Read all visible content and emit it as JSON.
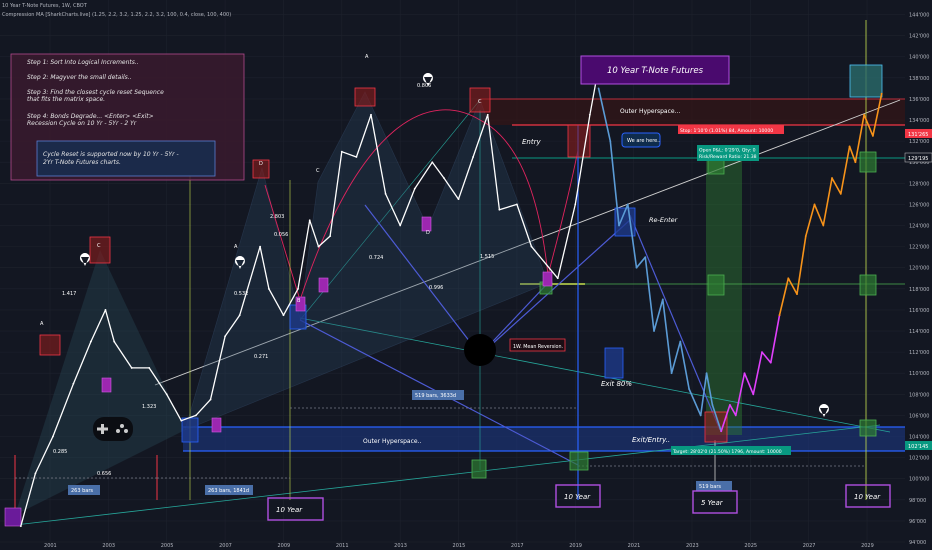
{
  "header": {
    "symbol_line": "10 Year T-Note Futures, 1W, CBOT",
    "indicator_line": "Compression MA [SharkCharts.live] (1.25, 2.2, 3.2, 1.25, 2.2, 3.2, 100, 0.4, close, 100, 400)"
  },
  "notes": {
    "steps": [
      "Step 1: Sort Into Logical Increments..",
      "Step 2: Magyver the small details..",
      "Step 3: Find the closest cycle reset Sequence",
      "that fits the matrix space.",
      "Step 4: Bonds Degrade... <Enter> <Exit>",
      "Recession Cycle on 10 Yr - 5Yr - 2 Yr"
    ],
    "cycle_box": [
      "Cycle Reset is supported now by 10 Yr - 5Yr -",
      "2Yr T-Note Futures charts."
    ]
  },
  "title_box": "10 Year T-Note Futures",
  "colors": {
    "background": "#131722",
    "price": "#ffffff",
    "projection_blue": "#5b9bd5",
    "projection_orange": "#f7931a",
    "projection_magenta": "#e040fb",
    "stop": "#f23645",
    "target": "#089981"
  },
  "labels": {
    "outer_top": "Outer Hyperspace...",
    "outer_bottom": "Outer Hyperspace..",
    "entry": "Entry",
    "we_are_here": "We are here..",
    "re_enter": "Re-Enter",
    "mean_reversion": "1W. Mean Reversion.",
    "exit80": "Exit 80%",
    "exit_entry": "Exit/Entry..",
    "ten_year": "10 Year",
    "five_year": "5 Year",
    "stop_label": "Stop: 1'10'0 (1.01%) 84, Amount: 10000",
    "pnl_1": "Open P&L: 0'29'0, Qty: 0",
    "pnl_2": "Risk/Reward Ratio: 21.38",
    "target_label": "Target: 28'02'0 (21.50%) 1796, Amount: 10000",
    "bars_519_a": "519 bars, 3633d",
    "bars_519_b": "519 bars",
    "bars_263_a": "263 bars",
    "bars_263_b": "263 bars, 1841d",
    "fibs": [
      "1.417",
      "0.285",
      "0.656",
      "1.323",
      "0.532",
      "0.271",
      "2.803",
      "0.056",
      "0.724",
      "0.996",
      "1.515",
      "0.806"
    ],
    "points": [
      "A",
      "B",
      "C",
      "D",
      "X"
    ]
  },
  "price_labels": {
    "stop": "131'265",
    "current": "129'195",
    "target": "102'145"
  },
  "chart_data": {
    "type": "line",
    "title": "10 Year T-Note Futures",
    "xlabel": "",
    "ylabel": "",
    "x_ticks": [
      "2001",
      "2003",
      "2005",
      "2007",
      "2009",
      "2011",
      "2013",
      "2015",
      "2017",
      "2019",
      "2021",
      "2023",
      "2025",
      "2027",
      "2029"
    ],
    "y_ticks": [
      "144'000",
      "142'000",
      "140'000",
      "138'000",
      "136'000",
      "134'000",
      "132'000",
      "130'000",
      "128'000",
      "126'000",
      "124'000",
      "122'000",
      "120'000",
      "118'000",
      "116'000",
      "114'000",
      "112'000",
      "110'000",
      "108'000",
      "106'000",
      "104'000",
      "102'000",
      "100'000",
      "98'000",
      "96'000",
      "94'000"
    ],
    "y_range": [
      94,
      145
    ],
    "x_range": [
      2000.3,
      2030.8
    ],
    "series": [
      {
        "x": [
          2000.5,
          2001.0,
          2001.6,
          2002.3,
          2002.9,
          2003.4,
          2003.7,
          2004.3,
          2004.9,
          2005.5,
          2006.0,
          2006.5,
          2007.0,
          2007.5,
          2008.0,
          2008.7,
          2009.0,
          2009.5,
          2010.0,
          2010.4,
          2010.7,
          2011.1,
          2011.5,
          2012.0,
          2012.5,
          2013.0,
          2013.5,
          2014.0,
          2014.6,
          2015.0,
          2015.5,
          2016.0,
          2016.5,
          2016.9,
          2017.5,
          2018.0,
          2018.9,
          2019.5,
          2020.0,
          2020.3
        ],
        "y": [
          95.5,
          100.5,
          104.0,
          109.0,
          113.0,
          116.0,
          113.0,
          110.5,
          110.5,
          108.0,
          105.5,
          106.0,
          107.5,
          113.5,
          115.5,
          122.0,
          118.0,
          115.5,
          118.0,
          124.5,
          122.0,
          123.0,
          131.0,
          130.5,
          134.5,
          127.0,
          124.0,
          127.5,
          130.0,
          128.5,
          126.5,
          130.5,
          134.5,
          125.5,
          126.0,
          122.0,
          119.0,
          126.0,
          134.5,
          139.0
        ]
      },
      {
        "x": [
          2020.3,
          2020.7,
          2021.0,
          2021.3,
          2021.6,
          2021.9,
          2022.2,
          2022.5,
          2022.8,
          2023.1,
          2023.4,
          2023.8,
          2024.0,
          2024.2,
          2024.5
        ],
        "y": [
          137.0,
          132.0,
          124.0,
          126.0,
          120.0,
          121.0,
          114.0,
          117.0,
          110.0,
          113.0,
          108.5,
          106.0,
          110.0,
          107.0,
          104.5
        ]
      },
      {
        "x": [
          2024.5,
          2024.8,
          2025.0,
          2025.3,
          2025.6,
          2025.9,
          2026.2,
          2026.5
        ],
        "y": [
          104.5,
          107.0,
          106.0,
          110.0,
          108.0,
          112.0,
          111.0,
          115.5
        ]
      },
      {
        "x": [
          2026.5,
          2026.8,
          2027.1,
          2027.4,
          2027.7,
          2028.0,
          2028.3,
          2028.6,
          2028.9,
          2029.1,
          2029.4,
          2029.7,
          2030.0
        ],
        "y": [
          115.5,
          119.0,
          117.5,
          123.0,
          126.0,
          124.0,
          128.5,
          127.0,
          131.5,
          130.0,
          134.5,
          132.5,
          136.5
        ]
      }
    ]
  }
}
